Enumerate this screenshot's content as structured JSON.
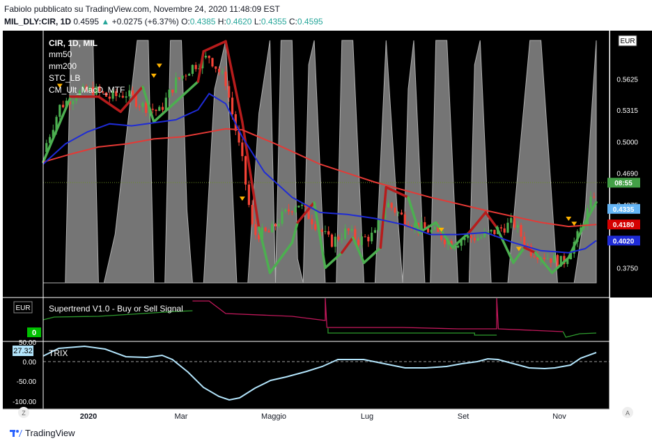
{
  "header": {
    "line1": "Fabiolo pubblicato su TradingView.com, Novembre 24, 2020 11:48:09 EST",
    "symbol": "MIL_DLY:CIR, 1D",
    "last": "0.4595",
    "change": "+0.0275 (+6.37%)",
    "open_k": "O:",
    "open_v": "0.4385",
    "high_k": "H:",
    "high_v": "0.4620",
    "low_k": "L:",
    "low_v": "0.4355",
    "close_k": "C:",
    "close_v": "0.4595"
  },
  "legend": {
    "title": "CIR, 1D, MIL",
    "items": [
      "mm50",
      "mm200",
      "STC_LB",
      "CM_Ult_MacD_MTF"
    ]
  },
  "price_axis": {
    "currency": "EUR",
    "ticks": [
      "0.5625",
      "0.5315",
      "0.5000",
      "0.4690",
      "0.4375",
      "0.4180",
      "0.4020",
      "0.3750"
    ],
    "badges": [
      {
        "label": "08:55",
        "value": 0.4595,
        "color": "#43a047"
      },
      {
        "label": "0.4335",
        "value": 0.4335,
        "color": "#64b5f6"
      },
      {
        "label": "0.4180",
        "value": 0.418,
        "color": "#d50000"
      },
      {
        "label": "0.4020",
        "value": 0.402,
        "color": "#1e2bd6"
      }
    ]
  },
  "supertrend": {
    "title": "Supertrend V1.0 - Buy or Sell Signal",
    "currency": "EUR",
    "badge": "0",
    "colors": {
      "buy": "#2e9c2e",
      "sell": "#c2185b"
    }
  },
  "trix": {
    "title": "TRIX",
    "ticks": [
      "50.00",
      "0.00",
      "-50.00",
      "-100.00"
    ],
    "badge": "27.32"
  },
  "time_axis": {
    "labels": [
      "2020",
      "Mar",
      "Maggio",
      "Lug",
      "Set",
      "Nov"
    ],
    "left_button": "Z",
    "right_button": "A"
  },
  "footer": {
    "brand": "TradingView"
  },
  "chart_data": {
    "type": "line",
    "title": "CIR, 1D, MIL",
    "x_labels": [
      "2020",
      "Mar",
      "Maggio",
      "Lug",
      "Set",
      "Nov"
    ],
    "ylim": [
      0.36,
      0.605
    ],
    "price": {
      "x": [
        0,
        3,
        6,
        9,
        12,
        15,
        18,
        21,
        24,
        27,
        30,
        33,
        36,
        38,
        41,
        43,
        46,
        49,
        52,
        55,
        57,
        60,
        62,
        65,
        68,
        71,
        74,
        76,
        79,
        82,
        85,
        88,
        91,
        94,
        97,
        100
      ],
      "y": [
        0.49,
        0.535,
        0.548,
        0.552,
        0.544,
        0.548,
        0.536,
        0.53,
        0.56,
        0.575,
        0.585,
        0.56,
        0.48,
        0.408,
        0.41,
        0.425,
        0.44,
        0.42,
        0.4,
        0.412,
        0.402,
        0.408,
        0.44,
        0.425,
        0.415,
        0.41,
        0.398,
        0.405,
        0.405,
        0.412,
        0.42,
        0.392,
        0.386,
        0.38,
        0.41,
        0.455
      ]
    },
    "series": [
      {
        "name": "mm50",
        "color": "#1e2bd6",
        "x": [
          0,
          4,
          8,
          12,
          16,
          20,
          24,
          28,
          30,
          33,
          36,
          40,
          45,
          50,
          55,
          60,
          65,
          70,
          75,
          80,
          85,
          90,
          95,
          98,
          100
        ],
        "y": [
          0.478,
          0.498,
          0.51,
          0.518,
          0.516,
          0.519,
          0.522,
          0.532,
          0.548,
          0.538,
          0.505,
          0.47,
          0.445,
          0.43,
          0.428,
          0.424,
          0.418,
          0.408,
          0.408,
          0.41,
          0.4,
          0.392,
          0.39,
          0.394,
          0.402
        ]
      },
      {
        "name": "mm200",
        "color": "#e53935",
        "x": [
          0,
          5,
          10,
          15,
          20,
          25,
          30,
          33,
          36,
          42,
          50,
          60,
          70,
          80,
          90,
          95,
          100
        ],
        "y": [
          0.48,
          0.488,
          0.495,
          0.498,
          0.503,
          0.505,
          0.51,
          0.513,
          0.512,
          0.498,
          0.478,
          0.46,
          0.445,
          0.432,
          0.42,
          0.416,
          0.418
        ]
      }
    ]
  }
}
